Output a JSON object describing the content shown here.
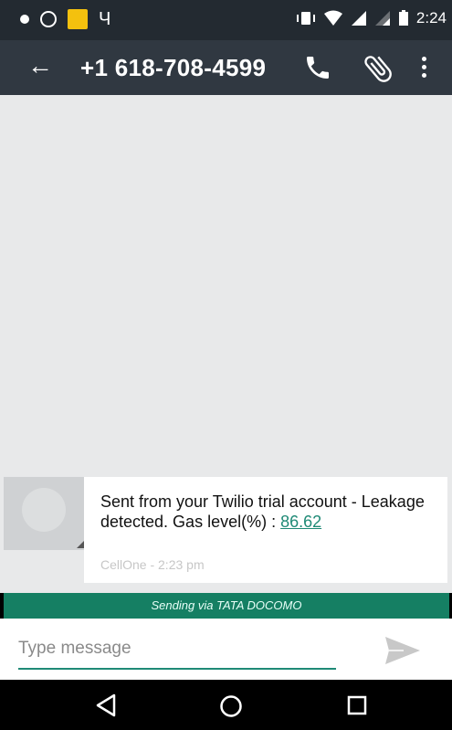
{
  "status_bar": {
    "time": "2:24"
  },
  "app_bar": {
    "contact": "+1 618-708-4599"
  },
  "message": {
    "line": "Sent from your Twilio trial account - Leakage detected. Gas level(%) : ",
    "value": "86.62",
    "meta": "CellOne - 2:23 pm"
  },
  "sending_bar": {
    "text": "Sending via TATA DOCOMO"
  },
  "composer": {
    "placeholder": "Type message"
  },
  "colors": {
    "accent": "#1f8a76",
    "app_bar": "#303841",
    "sending_bar": "#157f63"
  }
}
